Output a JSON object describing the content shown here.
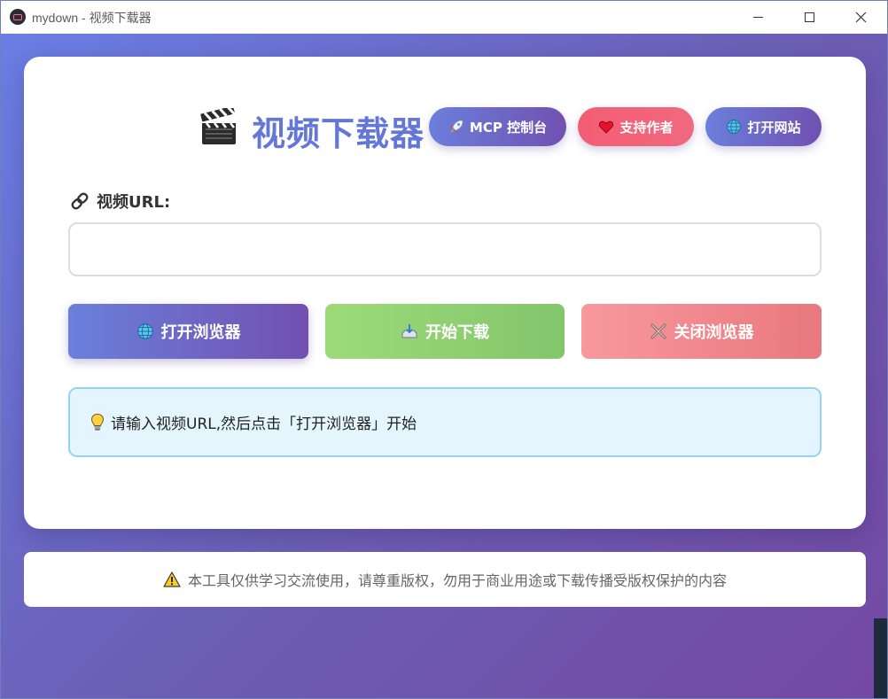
{
  "window": {
    "title": "mydown - 视频下载器",
    "icon": "app-screen-icon",
    "controls": [
      "minimize-icon",
      "maximize-icon",
      "close-icon"
    ]
  },
  "header": {
    "title_icon": "clapperboard-icon",
    "title": "视频下载器",
    "buttons": {
      "mcp": {
        "icon": "rocket-icon",
        "label": "MCP 控制台"
      },
      "support": {
        "icon": "heart-icon",
        "label": "支持作者"
      },
      "website": {
        "icon": "globe-icon",
        "label": "打开网站"
      }
    }
  },
  "url_field": {
    "icon": "link-icon",
    "label": "视频URL:",
    "value": "",
    "placeholder": ""
  },
  "actions": {
    "open_browser": {
      "icon": "globe-icon",
      "label": "打开浏览器"
    },
    "start_download": {
      "icon": "download-tray-icon",
      "label": "开始下载"
    },
    "close_browser": {
      "icon": "cross-icon",
      "label": "关闭浏览器"
    }
  },
  "info": {
    "icon": "lightbulb-icon",
    "text": "请输入视频URL,然后点击「打开浏览器」开始"
  },
  "footer": {
    "icon": "warning-icon",
    "text": "本工具仅供学习交流使用，请尊重版权，勿用于商业用途或下载传播受版权保护的内容"
  },
  "colors": {
    "accent": "#6477d9",
    "gradient_start": "#6a7ee4",
    "gradient_end": "#7448a2",
    "support_red": "#f45d74",
    "download_green": "#8fcf72",
    "close_pink": "#ee858b",
    "info_bg": "#e5f5fd",
    "info_border": "#93d3f3"
  }
}
